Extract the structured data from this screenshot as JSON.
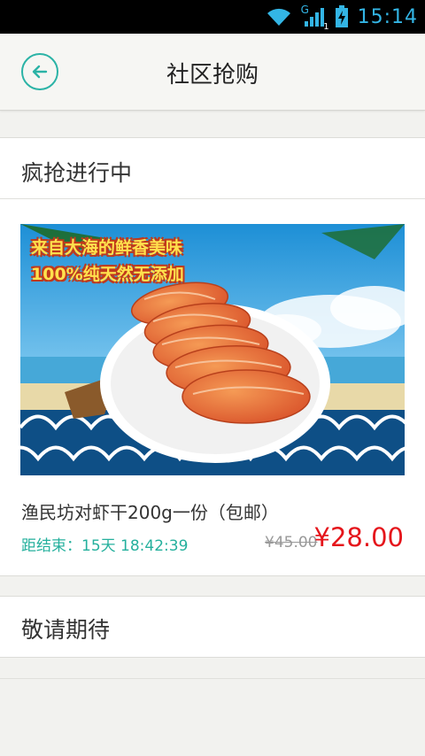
{
  "status_bar": {
    "time": "15:14",
    "network_label": "G",
    "sim_label": "1",
    "icons": [
      "wifi-icon",
      "signal-icon",
      "battery-charging-icon"
    ]
  },
  "header": {
    "title": "社区抢购",
    "back_icon": "arrow-left-icon"
  },
  "sections": {
    "ongoing_title": "疯抢进行中",
    "upcoming_title": "敬请期待"
  },
  "product": {
    "banner_line1": "来自大海的鲜香美味",
    "banner_line2": "100%纯天然无添加",
    "name": "渔民坊对虾干200g一份（包邮）",
    "countdown": "距结束：15天 18:42:39",
    "original_price": "¥45.00",
    "sale_price": "¥28.00"
  },
  "colors": {
    "accent": "#2bb3a6",
    "price": "#e5151b",
    "status": "#33b5e5"
  }
}
